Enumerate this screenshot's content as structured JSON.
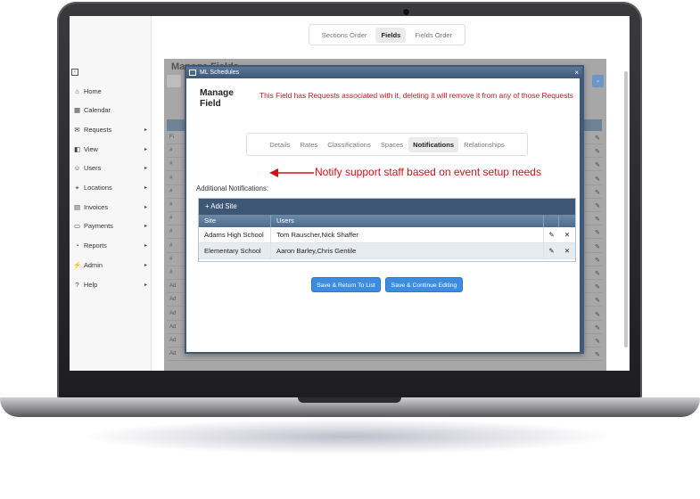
{
  "nav": {
    "items": [
      {
        "label": "Home",
        "icon": "home-icon",
        "glyph": "⌂",
        "has_children": false
      },
      {
        "label": "Calendar",
        "icon": "calendar-icon",
        "glyph": "▦",
        "has_children": false
      },
      {
        "label": "Requests",
        "icon": "requests-icon",
        "glyph": "✉",
        "has_children": true
      },
      {
        "label": "View",
        "icon": "view-icon",
        "glyph": "◧",
        "has_children": true
      },
      {
        "label": "Users",
        "icon": "users-icon",
        "glyph": "☺",
        "has_children": true
      },
      {
        "label": "Locations",
        "icon": "locations-icon",
        "glyph": "⌖",
        "has_children": true
      },
      {
        "label": "Invoices",
        "icon": "invoices-icon",
        "glyph": "▤",
        "has_children": true
      },
      {
        "label": "Payments",
        "icon": "payments-icon",
        "glyph": "▭",
        "has_children": true
      },
      {
        "label": "Reports",
        "icon": "reports-icon",
        "glyph": "◔",
        "has_children": true
      },
      {
        "label": "Admin",
        "icon": "admin-icon",
        "glyph": "⚡",
        "has_children": true
      },
      {
        "label": "Help",
        "icon": "help-icon",
        "glyph": "?",
        "has_children": true
      }
    ],
    "chevron": "▸"
  },
  "top_tabs": [
    {
      "label": "Sections Order",
      "active": false
    },
    {
      "label": "Fields",
      "active": true
    },
    {
      "label": "Fields Order",
      "active": false
    }
  ],
  "background": {
    "title": "Manage Fields",
    "row_markers": [
      "Fi",
      "#",
      "#",
      "#",
      "#",
      "#",
      "#",
      "#",
      "#",
      "#",
      "#",
      "Ad",
      "Ad",
      "Ad",
      "Ad",
      "Ad",
      "Ad"
    ],
    "last_row": "Ad"
  },
  "modal": {
    "window_title": "ML Schedules",
    "close_glyph": "×",
    "title": "Manage Field",
    "warning": "This Field has Requests associated with it, deleting it will remove it from any of those Requests",
    "tabs": [
      {
        "label": "Details",
        "active": false
      },
      {
        "label": "Rates",
        "active": false
      },
      {
        "label": "Classifications",
        "active": false
      },
      {
        "label": "Spaces",
        "active": false
      },
      {
        "label": "Notifications",
        "active": true
      },
      {
        "label": "Relationships",
        "active": false
      }
    ],
    "additional_label": "Additional Notifications:",
    "grid": {
      "add_label": "+ Add Site",
      "columns": [
        "Site",
        "Users"
      ],
      "rows": [
        {
          "site": "Adams High School",
          "users": "Tom Rauscher,Nick Shaffer"
        },
        {
          "site": "Elementary School",
          "users": "Aaron Barley,Chris Gentile"
        }
      ],
      "edit_glyph": "✎",
      "delete_glyph": "✕"
    },
    "buttons": {
      "save_return": "Save & Return To List",
      "save_continue": "Save & Continue Editing"
    }
  },
  "annotation": {
    "text": "Notify support staff based on event setup needs",
    "color": "#d01416"
  },
  "colors": {
    "accent": "#3c8de0",
    "header": "#3d5775",
    "warning": "#c61820"
  }
}
